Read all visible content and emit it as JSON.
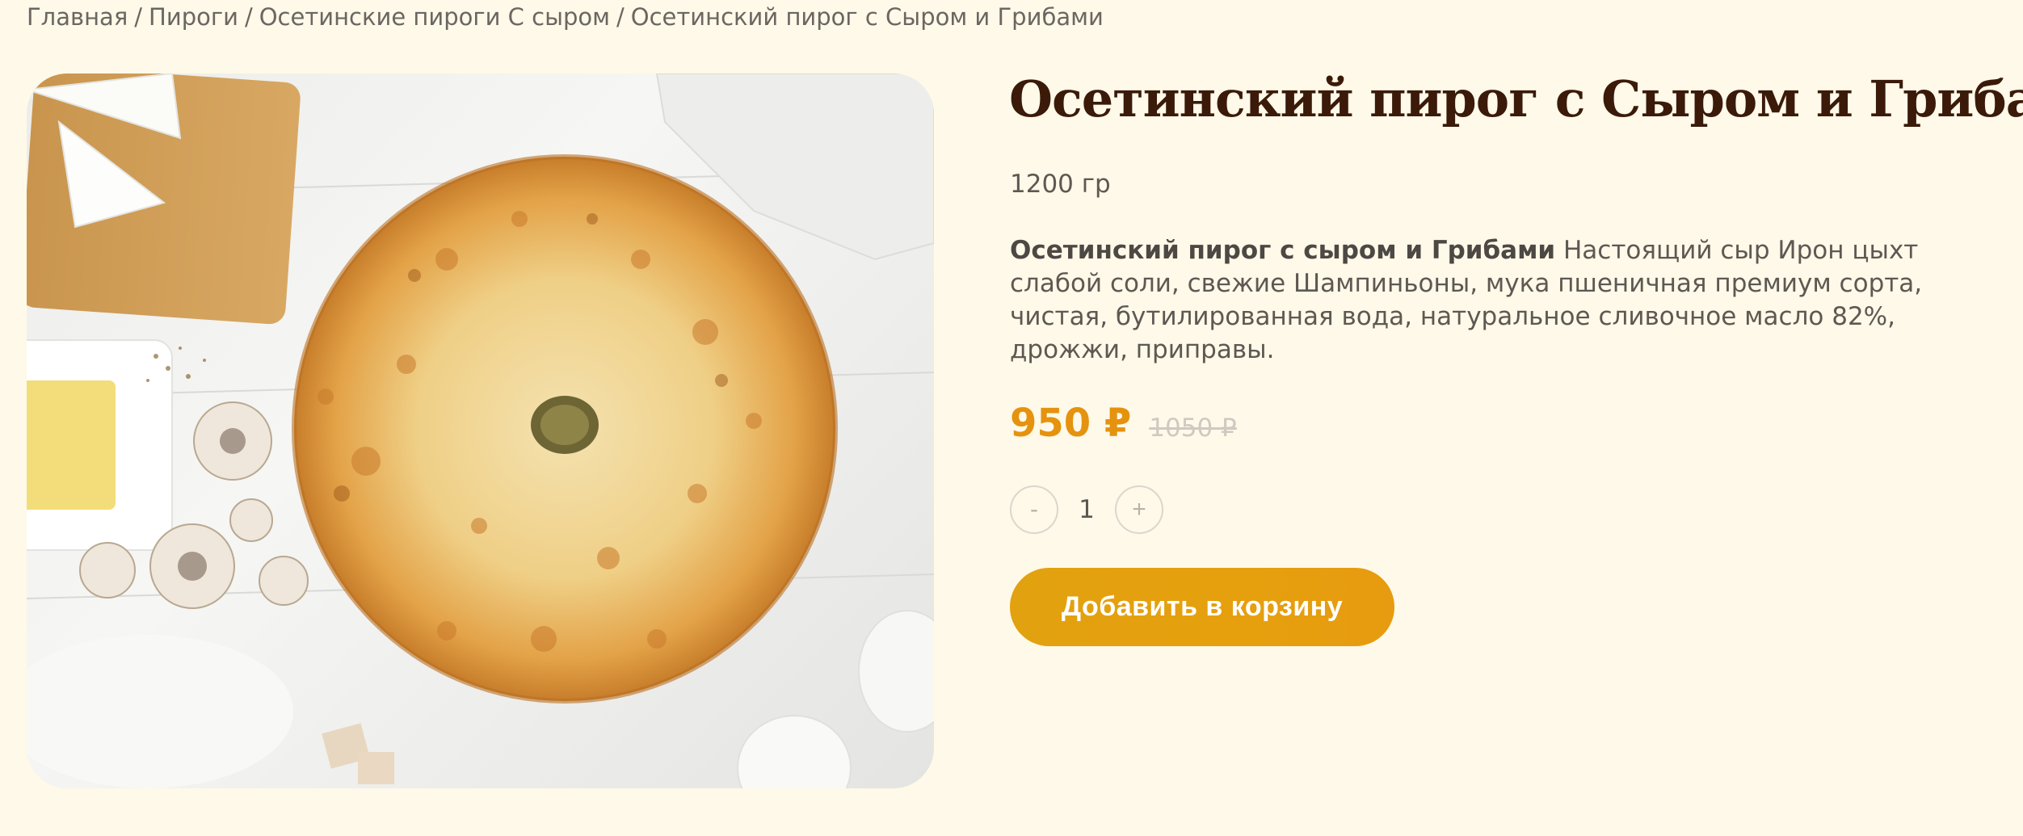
{
  "breadcrumb": {
    "items": [
      "Главная",
      "Пироги",
      "Осетинские пироги С сыром",
      "Осетинский пирог с Сыром и Грибами"
    ],
    "separator": "/"
  },
  "product": {
    "title": "Осетинский пирог с Сыром и Грибами",
    "weight": "1200 гр",
    "description_bold": "Осетинский пирог с сыром и Грибами",
    "description": " Настоящий сыр Ирон цыхт слабой соли, свежие Шампиньоны, мука пшеничная премиум сорта, чистая, бутилированная вода, натуральное сливочное масло 82%, дрожжи, приправы.",
    "price": "950 ₽",
    "old_price": "1050 ₽",
    "quantity": "1",
    "minus_label": "-",
    "plus_label": "+",
    "add_to_cart_label": "Добавить в корзину"
  },
  "colors": {
    "background": "#fef9e8",
    "accent": "#e5920e",
    "title": "#3b1a0a"
  }
}
